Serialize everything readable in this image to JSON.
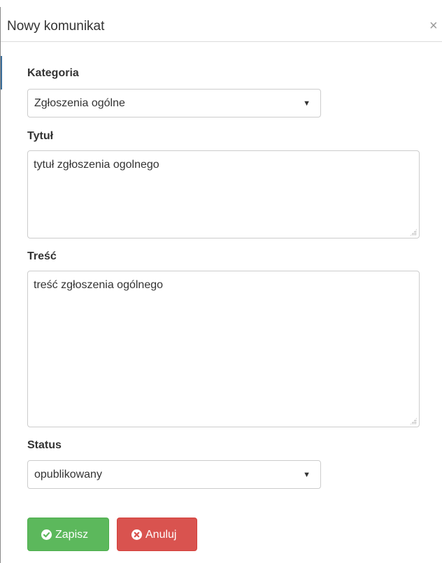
{
  "dialog": {
    "title": "Nowy komunikat",
    "close_symbol": "×",
    "colors": {
      "save_button": "#5cb85c",
      "cancel_button": "#d9534f",
      "border": "#cccccc"
    }
  },
  "form": {
    "category": {
      "label": "Kategoria",
      "selected": "Zgłoszenia ogólne",
      "caret": "▼"
    },
    "title_field": {
      "label": "Tytuł",
      "value": "tytuł zgłoszenia ogolnego"
    },
    "content_field": {
      "label": "Treść",
      "value": "treść zgłoszenia ogólnego"
    },
    "status": {
      "label": "Status",
      "selected": "opublikowany",
      "caret": "▼"
    }
  },
  "actions": {
    "save_label": "Zapisz",
    "save_icon": "check-circle-icon",
    "cancel_label": "Anuluj",
    "cancel_icon": "times-circle-icon"
  }
}
